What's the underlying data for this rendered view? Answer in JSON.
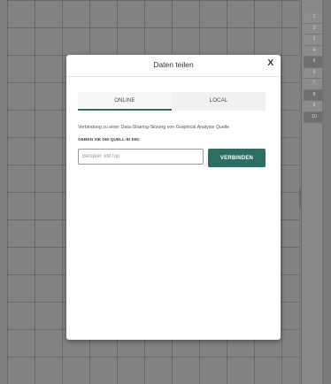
{
  "dialog": {
    "title": "Daten teilen",
    "close_label": "X",
    "tabs": [
      {
        "label": "ONLINE",
        "active": true
      },
      {
        "label": "LOCAL",
        "active": false
      }
    ],
    "info_text": "Verbindung zu einer Data-Sharing-Sitzung von Graphical Analysis Quelle",
    "id_label": "GEBEN SIE DIE QUELL-ID EIN:",
    "id_input": {
      "value": "",
      "placeholder": "Beispiel: kM7op"
    },
    "connect_label": "VERBINDEN"
  },
  "data_table": {
    "row_numbers": [
      "1",
      "2",
      "3",
      "4",
      "5",
      "6",
      "7",
      "8",
      "9",
      "10"
    ]
  },
  "colors": {
    "accent": "#2c6e63",
    "overlay": "#7d7d7d"
  }
}
